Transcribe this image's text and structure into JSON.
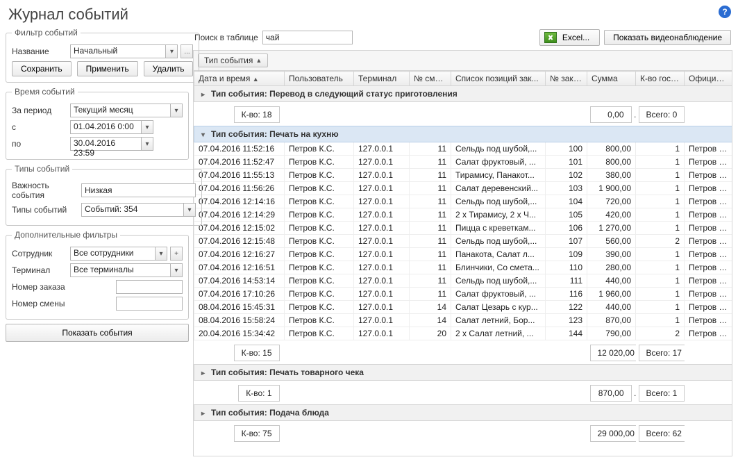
{
  "title": "Журнал событий",
  "help_icon": "?",
  "left": {
    "filter_legend": "Фильтр событий",
    "name_label": "Название",
    "name_value": "Начальный",
    "ellipsis": "...",
    "save": "Сохранить",
    "apply": "Применить",
    "delete": "Удалить",
    "time_legend": "Время событий",
    "period_label": "За период",
    "period_value": "Текущий месяц",
    "from_label": "с",
    "from_value": "01.04.2016 0:00",
    "to_label": "по",
    "to_value": "30.04.2016 23:59",
    "types_legend": "Типы событий",
    "importance_label": "Важность события",
    "importance_value": "Низкая",
    "types_label": "Типы событий",
    "types_value": "Событий: 354",
    "extra_legend": "Дополнительные фильтры",
    "employee_label": "Сотрудник",
    "employee_value": "Все сотрудники",
    "terminal_label": "Терминал",
    "terminal_value": "Все терминалы",
    "order_no_label": "Номер заказа",
    "order_no_value": "",
    "shift_no_label": "Номер смены",
    "shift_no_value": "",
    "show_events": "Показать события"
  },
  "right": {
    "search_label": "Поиск в таблице",
    "search_value": "чай",
    "excel": "Excel...",
    "show_video": "Показать видеонаблюдение",
    "groupby_field": "Тип события",
    "columns": {
      "datetime": "Дата и время",
      "user": "Пользователь",
      "terminal": "Терминал",
      "shift": "№ смены",
      "items": "Список позиций зак...",
      "order": "№ заказа",
      "sum": "Сумма",
      "guests": "К-во гостей",
      "waiter": "Официант"
    },
    "groups": [
      {
        "title": "Тип события: Перевод в следующий статус приготовления",
        "expanded": false,
        "selected": false,
        "count_label": "К-во: 18",
        "sum": "0,00",
        "total_label": "Всего: 0",
        "rows": []
      },
      {
        "title": "Тип события: Печать на кухню",
        "expanded": true,
        "selected": true,
        "count_label": "К-во: 15",
        "sum": "12 020,00",
        "total_label": "Всего: 17",
        "rows": [
          {
            "dt": "07.04.2016 11:52:16",
            "user": "Петров К.С.",
            "term": "127.0.0.1",
            "shift": "11",
            "items": "Сельдь под шубой,...",
            "order": "100",
            "sum": "800,00",
            "guests": "1",
            "waiter": "Петров К.С."
          },
          {
            "dt": "07.04.2016 11:52:47",
            "user": "Петров К.С.",
            "term": "127.0.0.1",
            "shift": "11",
            "items": "Салат фруктовый, ...",
            "order": "101",
            "sum": "800,00",
            "guests": "1",
            "waiter": "Петров К.С."
          },
          {
            "dt": "07.04.2016 11:55:13",
            "user": "Петров К.С.",
            "term": "127.0.0.1",
            "shift": "11",
            "items": "Тирамису, Панакот...",
            "order": "102",
            "sum": "380,00",
            "guests": "1",
            "waiter": "Петров К.С."
          },
          {
            "dt": "07.04.2016 11:56:26",
            "user": "Петров К.С.",
            "term": "127.0.0.1",
            "shift": "11",
            "items": "Салат деревенский...",
            "order": "103",
            "sum": "1 900,00",
            "guests": "1",
            "waiter": "Петров К.С."
          },
          {
            "dt": "07.04.2016 12:14:16",
            "user": "Петров К.С.",
            "term": "127.0.0.1",
            "shift": "11",
            "items": "Сельдь под шубой,...",
            "order": "104",
            "sum": "720,00",
            "guests": "1",
            "waiter": "Петров К.С."
          },
          {
            "dt": "07.04.2016 12:14:29",
            "user": "Петров К.С.",
            "term": "127.0.0.1",
            "shift": "11",
            "items": "2 х Тирамису, 2 х Ч...",
            "order": "105",
            "sum": "420,00",
            "guests": "1",
            "waiter": "Петров К.С."
          },
          {
            "dt": "07.04.2016 12:15:02",
            "user": "Петров К.С.",
            "term": "127.0.0.1",
            "shift": "11",
            "items": "Пицца с креветкам...",
            "order": "106",
            "sum": "1 270,00",
            "guests": "1",
            "waiter": "Петров К.С."
          },
          {
            "dt": "07.04.2016 12:15:48",
            "user": "Петров К.С.",
            "term": "127.0.0.1",
            "shift": "11",
            "items": "Сельдь под шубой,...",
            "order": "107",
            "sum": "560,00",
            "guests": "2",
            "waiter": "Петров К.С."
          },
          {
            "dt": "07.04.2016 12:16:27",
            "user": "Петров К.С.",
            "term": "127.0.0.1",
            "shift": "11",
            "items": "Панакота, Салат л...",
            "order": "109",
            "sum": "390,00",
            "guests": "1",
            "waiter": "Петров К.С."
          },
          {
            "dt": "07.04.2016 12:16:51",
            "user": "Петров К.С.",
            "term": "127.0.0.1",
            "shift": "11",
            "items": "Блинчики, Со смета...",
            "order": "110",
            "sum": "280,00",
            "guests": "1",
            "waiter": "Петров К.С."
          },
          {
            "dt": "07.04.2016 14:53:14",
            "user": "Петров К.С.",
            "term": "127.0.0.1",
            "shift": "11",
            "items": "Сельдь под шубой,...",
            "order": "111",
            "sum": "440,00",
            "guests": "1",
            "waiter": "Петров К.С."
          },
          {
            "dt": "07.04.2016 17:10:26",
            "user": "Петров К.С.",
            "term": "127.0.0.1",
            "shift": "11",
            "items": "Салат фруктовый, ...",
            "order": "116",
            "sum": "1 960,00",
            "guests": "1",
            "waiter": "Петров К.С."
          },
          {
            "dt": "08.04.2016 15:45:31",
            "user": "Петров К.С.",
            "term": "127.0.0.1",
            "shift": "14",
            "items": "Салат Цезарь с кур...",
            "order": "122",
            "sum": "440,00",
            "guests": "1",
            "waiter": "Петров К.С."
          },
          {
            "dt": "08.04.2016 15:58:24",
            "user": "Петров К.С.",
            "term": "127.0.0.1",
            "shift": "14",
            "items": "Салат летний, Бор...",
            "order": "123",
            "sum": "870,00",
            "guests": "1",
            "waiter": "Петров К.С."
          },
          {
            "dt": "20.04.2016 15:34:42",
            "user": "Петров К.С.",
            "term": "127.0.0.1",
            "shift": "20",
            "items": "2 х Салат летний, ...",
            "order": "144",
            "sum": "790,00",
            "guests": "2",
            "waiter": "Петров К.С."
          }
        ]
      },
      {
        "title": "Тип события: Печать товарного чека",
        "expanded": false,
        "selected": false,
        "count_label": "К-во: 1",
        "sum": "870,00",
        "total_label": "Всего: 1",
        "rows": []
      },
      {
        "title": "Тип события: Подача блюда",
        "expanded": false,
        "selected": false,
        "count_label": "К-во: 75",
        "sum": "29 000,00",
        "total_label": "Всего: 62",
        "rows": []
      }
    ]
  }
}
